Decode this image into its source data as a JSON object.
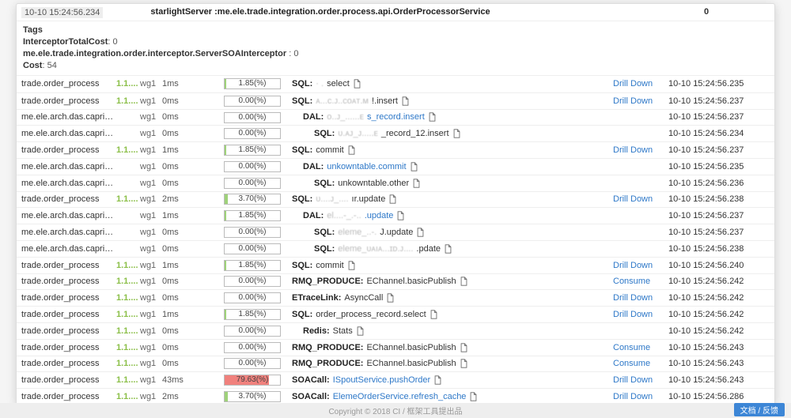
{
  "header": {
    "timestamp": "10-10 15:24:56.234",
    "service": "starlightServer :me.ele.trade.integration.order.process.api.OrderProcessorService",
    "count": "0"
  },
  "meta": {
    "tags_label": "Tags",
    "interceptor_label": "InterceptorTotalCost",
    "interceptor_val": "0",
    "soa_label": "me.ele.trade.integration.order.interceptor.ServerSOAInterceptor",
    "soa_val": "0",
    "cost_label": "Cost",
    "cost_val": "54"
  },
  "actions": {
    "drill": "Drill Down",
    "consume": "Consume"
  },
  "rows": [
    {
      "svc": "trade.order_process",
      "ver": "1.1....",
      "node": "wg1",
      "dur": "1ms",
      "pct": "1.85(%)",
      "w": 3,
      "indent": 0,
      "kind": "SQL:",
      "blur": "·      .",
      "text": "select",
      "link": false,
      "act": "drill",
      "time": "10-10 15:24:56.235"
    },
    {
      "svc": "trade.order_process",
      "ver": "1.1....",
      "node": "wg1",
      "dur": "0ms",
      "pct": "0.00(%)",
      "w": 0,
      "indent": 0,
      "kind": "SQL:",
      "blur": "ᴀ...ᴄ.ᴊ..ᴄᴏᴀᴛ.ᴍ",
      "text": "!.insert",
      "link": false,
      "act": "drill",
      "time": "10-10 15:24:56.237"
    },
    {
      "svc": "me.ele.arch.das.capricorn...",
      "ver": "",
      "node": "wg1",
      "dur": "0ms",
      "pct": "0.00(%)",
      "w": 0,
      "indent": 1,
      "kind": "DAL:",
      "blur": "ᴏ..ᴊ_......ᴇ",
      "text": "s_record.insert",
      "link": true,
      "act": "",
      "time": "10-10 15:24:56.237"
    },
    {
      "svc": "me.ele.arch.das.capricorn...",
      "ver": "",
      "node": "wg1",
      "dur": "0ms",
      "pct": "0.00(%)",
      "w": 0,
      "indent": 2,
      "kind": "SQL:",
      "blur": "ᴜ.ᴀᴊ_ᴊ.....ᴇ",
      "text": "_record_12.insert",
      "link": false,
      "act": "",
      "time": "10-10 15:24:56.234"
    },
    {
      "svc": "trade.order_process",
      "ver": "1.1....",
      "node": "wg1",
      "dur": "1ms",
      "pct": "1.85(%)",
      "w": 3,
      "indent": 0,
      "kind": "SQL:",
      "blur": "",
      "text": "commit",
      "link": false,
      "act": "drill",
      "time": "10-10 15:24:56.237"
    },
    {
      "svc": "me.ele.arch.das.capricorn...",
      "ver": "",
      "node": "wg1",
      "dur": "0ms",
      "pct": "0.00(%)",
      "w": 0,
      "indent": 1,
      "kind": "DAL:",
      "blur": "",
      "text": "unkowntable.commit",
      "link": true,
      "act": "",
      "time": "10-10 15:24:56.235"
    },
    {
      "svc": "me.ele.arch.das.capricorn...",
      "ver": "",
      "node": "wg1",
      "dur": "0ms",
      "pct": "0.00(%)",
      "w": 0,
      "indent": 2,
      "kind": "SQL:",
      "blur": "",
      "text": "unkowntable.other",
      "link": false,
      "act": "",
      "time": "10-10 15:24:56.236"
    },
    {
      "svc": "trade.order_process",
      "ver": "1.1....",
      "node": "wg1",
      "dur": "2ms",
      "pct": "3.70(%)",
      "w": 6,
      "indent": 0,
      "kind": "SQL:",
      "blur": "ᴜ....ᴊ_....",
      "text": "ır.update",
      "link": false,
      "act": "drill",
      "time": "10-10 15:24:56.238"
    },
    {
      "svc": "me.ele.arch.das.capricorn...",
      "ver": "",
      "node": "wg1",
      "dur": "1ms",
      "pct": "1.85(%)",
      "w": 3,
      "indent": 1,
      "kind": "DAL:",
      "blur": "el....-_.-..",
      "text": ".update",
      "link": true,
      "act": "",
      "time": "10-10 15:24:56.237"
    },
    {
      "svc": "me.ele.arch.das.capricorn...",
      "ver": "",
      "node": "wg1",
      "dur": "0ms",
      "pct": "0.00(%)",
      "w": 0,
      "indent": 2,
      "kind": "SQL:",
      "blur": "eleme_..-.      ",
      "text": "J.update",
      "link": false,
      "act": "",
      "time": "10-10 15:24:56.237"
    },
    {
      "svc": "me.ele.arch.das.capricorn...",
      "ver": "",
      "node": "wg1",
      "dur": "0ms",
      "pct": "0.00(%)",
      "w": 0,
      "indent": 2,
      "kind": "SQL:",
      "blur": "eleme_ᴜᴀıᴀ...ɪᴅ.ᴊ....",
      "text": ".pdate",
      "link": false,
      "act": "",
      "time": "10-10 15:24:56.238"
    },
    {
      "svc": "trade.order_process",
      "ver": "1.1....",
      "node": "wg1",
      "dur": "1ms",
      "pct": "1.85(%)",
      "w": 3,
      "indent": 0,
      "kind": "SQL:",
      "blur": "",
      "text": "commit",
      "link": false,
      "act": "drill",
      "time": "10-10 15:24:56.240"
    },
    {
      "svc": "trade.order_process",
      "ver": "1.1....",
      "node": "wg1",
      "dur": "0ms",
      "pct": "0.00(%)",
      "w": 0,
      "indent": 0,
      "kind": "RMQ_PRODUCE:",
      "blur": "",
      "text": "EChannel.basicPublish",
      "link": false,
      "act": "consume",
      "time": "10-10 15:24:56.242"
    },
    {
      "svc": "trade.order_process",
      "ver": "1.1....",
      "node": "wg1",
      "dur": "0ms",
      "pct": "0.00(%)",
      "w": 0,
      "indent": 0,
      "kind": "ETraceLink:",
      "blur": "",
      "text": "AsyncCall",
      "link": false,
      "act": "drill",
      "time": "10-10 15:24:56.242"
    },
    {
      "svc": "trade.order_process",
      "ver": "1.1....",
      "node": "wg1",
      "dur": "1ms",
      "pct": "1.85(%)",
      "w": 3,
      "indent": 0,
      "kind": "SQL:",
      "blur": "",
      "text": "order_process_record.select",
      "link": false,
      "act": "drill",
      "time": "10-10 15:24:56.242"
    },
    {
      "svc": "trade.order_process",
      "ver": "1.1....",
      "node": "wg1",
      "dur": "0ms",
      "pct": "0.00(%)",
      "w": 0,
      "indent": 1,
      "kind": "Redis:",
      "blur": "",
      "text": "Stats",
      "link": false,
      "act": "",
      "time": "10-10 15:24:56.242"
    },
    {
      "svc": "trade.order_process",
      "ver": "1.1....",
      "node": "wg1",
      "dur": "0ms",
      "pct": "0.00(%)",
      "w": 0,
      "indent": 0,
      "kind": "RMQ_PRODUCE:",
      "blur": "",
      "text": "EChannel.basicPublish",
      "link": false,
      "act": "consume",
      "time": "10-10 15:24:56.243"
    },
    {
      "svc": "trade.order_process",
      "ver": "1.1....",
      "node": "wg1",
      "dur": "0ms",
      "pct": "0.00(%)",
      "w": 0,
      "indent": 0,
      "kind": "RMQ_PRODUCE:",
      "blur": "",
      "text": "EChannel.basicPublish",
      "link": false,
      "act": "consume",
      "time": "10-10 15:24:56.243"
    },
    {
      "svc": "trade.order_process",
      "ver": "1.1....",
      "node": "wg1",
      "dur": "43ms",
      "pct": "79.63(%)",
      "w": 80,
      "hot": true,
      "indent": 0,
      "kind": "SOACall:",
      "blur": "",
      "text": "ISpoutService.pushOrder",
      "link": true,
      "act": "drill",
      "time": "10-10 15:24:56.243"
    },
    {
      "svc": "trade.order_process",
      "ver": "1.1....",
      "node": "wg1",
      "dur": "2ms",
      "pct": "3.70(%)",
      "w": 6,
      "indent": 0,
      "kind": "SOACall:",
      "blur": "",
      "text": "ElemeOrderService.refresh_cache",
      "link": true,
      "act": "drill",
      "time": "10-10 15:24:56.286"
    }
  ],
  "footer": {
    "copy": "Copyright © 2018 CI / 框架工具提出品",
    "badge": "文档 / 反馈"
  }
}
